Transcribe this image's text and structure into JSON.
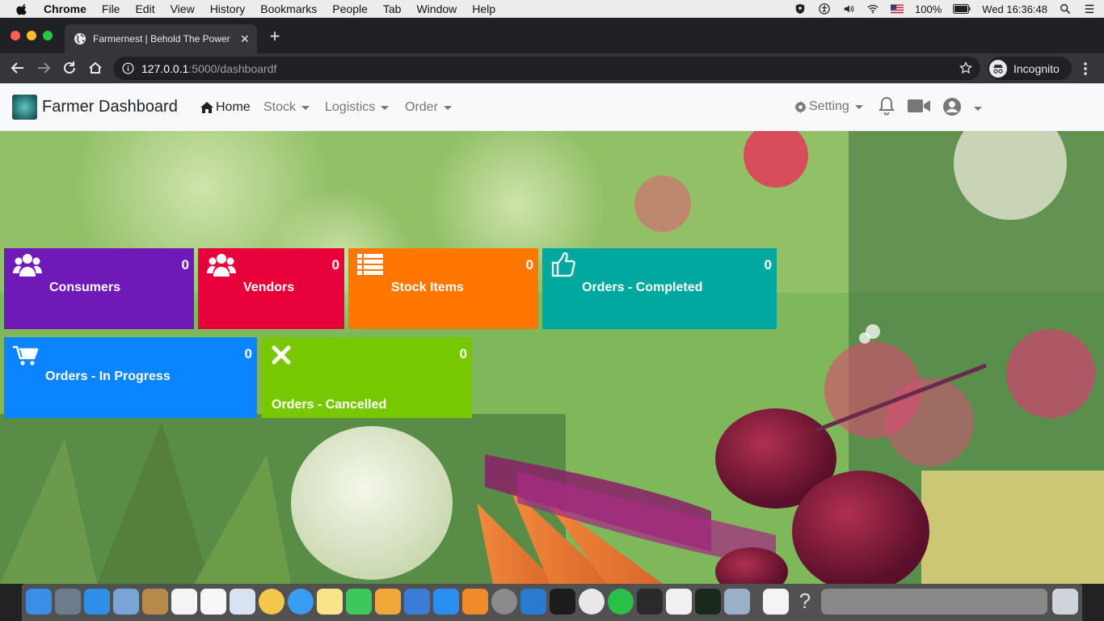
{
  "menubar": {
    "app": "Chrome",
    "items": [
      "File",
      "Edit",
      "View",
      "History",
      "Bookmarks",
      "People",
      "Tab",
      "Window",
      "Help"
    ],
    "battery": "100%",
    "clock": "Wed 16:36:48"
  },
  "browser": {
    "tab_title": "Farmernest | Behold The Power",
    "url_host": "127.0.0.1",
    "url_path": ":5000/dashboardf",
    "incognito_label": "Incognito"
  },
  "navbar": {
    "brand": "Farmer Dashboard",
    "home": "Home",
    "stock": "Stock",
    "logistics": "Logistics",
    "order": "Order",
    "setting": "Setting"
  },
  "tiles": [
    {
      "label": "Consumers",
      "count": "0",
      "color": "#6f1ab8",
      "icon": "users-icon"
    },
    {
      "label": "Vendors",
      "count": "0",
      "color": "#e8003a",
      "icon": "users-icon"
    },
    {
      "label": "Stock Items",
      "count": "0",
      "color": "#ff7700",
      "icon": "list-icon"
    },
    {
      "label": "Orders - Completed",
      "count": "0",
      "color": "#00a89f",
      "icon": "thumbs-up-icon"
    },
    {
      "label": "Orders - In Progress",
      "count": "0",
      "color": "#0a84ff",
      "icon": "cart-icon"
    },
    {
      "label": "Orders - Cancelled",
      "count": "0",
      "color": "#78c800",
      "icon": "close-icon"
    }
  ]
}
